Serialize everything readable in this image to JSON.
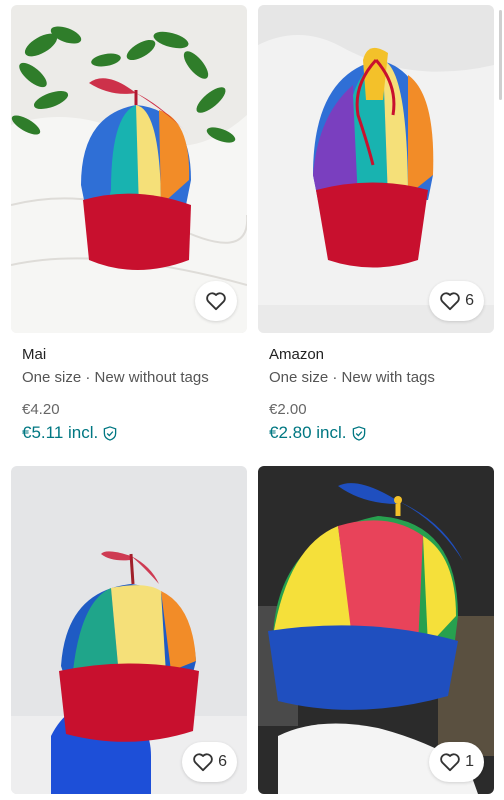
{
  "products": [
    {
      "brand": "Mai",
      "meta": "One size · New without tags",
      "price": "€4.20",
      "price_incl": "€5.11 incl.",
      "favorites": "",
      "image": "rainbow-propeller-cap-on-bed-with-plant"
    },
    {
      "brand": "Amazon",
      "meta": "One size · New with tags",
      "price": "€2.00",
      "price_incl": "€2.80 incl.",
      "favorites": "6",
      "image": "rainbow-propeller-cap-with-tag"
    },
    {
      "favorites": "6",
      "image": "rainbow-propeller-cap-on-blue-stand"
    },
    {
      "favorites": "1",
      "image": "primary-color-propeller-cap"
    }
  ],
  "colors": {
    "accent": "#007782",
    "cap_red": "#c8102e",
    "cap_blue": "#1f4fbf"
  },
  "icons": {
    "favorite": "heart-outline-icon",
    "buyer_protection": "shield-check-icon"
  }
}
